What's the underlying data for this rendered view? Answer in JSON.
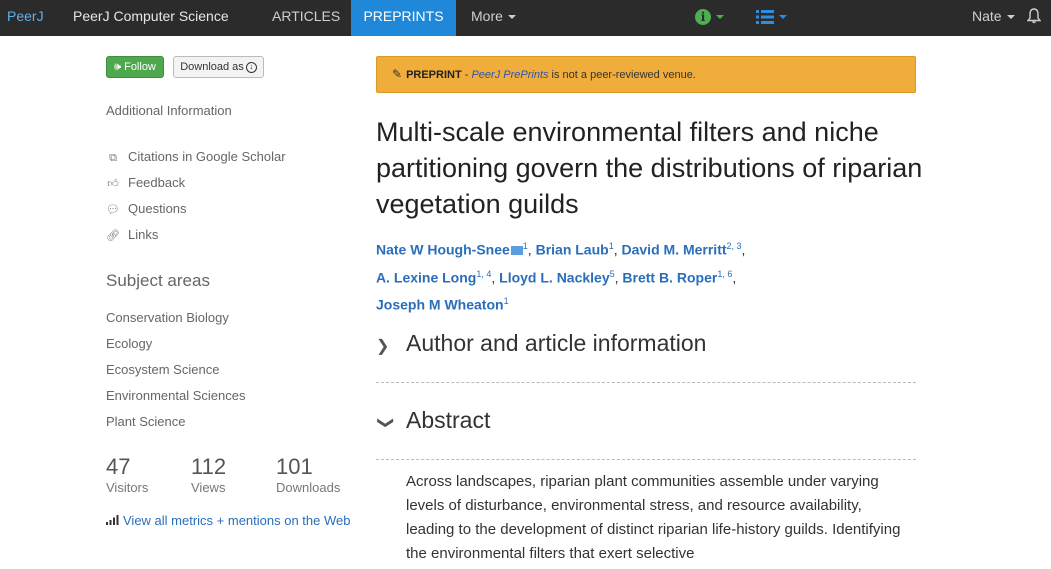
{
  "navbar": {
    "logo": "PeerJ",
    "journal": "PeerJ Computer Science",
    "articles": "ARTICLES",
    "preprints": "PREPRINTS",
    "more": "More",
    "user": "Nate",
    "colors": {
      "bg": "#2b2b2b",
      "active": "#1f88d9",
      "info": "#4caf50",
      "list": "#2d8de0"
    }
  },
  "sidebar": {
    "follow": "Follow",
    "download": "Download as",
    "additional_info": "Additional Information",
    "links": [
      {
        "icon": "copy-icon",
        "label": "Citations in Google Scholar"
      },
      {
        "icon": "thumbs-up-icon",
        "label": "Feedback"
      },
      {
        "icon": "comments-icon",
        "label": "Questions"
      },
      {
        "icon": "link-icon",
        "label": "Links"
      }
    ],
    "subject_heading": "Subject areas",
    "subjects": [
      "Conservation Biology",
      "Ecology",
      "Ecosystem Science",
      "Environmental Sciences",
      "Plant Science"
    ],
    "stats": [
      {
        "value": "47",
        "label": "Visitors"
      },
      {
        "value": "112",
        "label": "Views"
      },
      {
        "value": "101",
        "label": "Downloads"
      }
    ],
    "metrics_link": "View all metrics + mentions on the Web"
  },
  "banner": {
    "strong": "PREPRINT",
    "sep": " - ",
    "link": "PeerJ PrePrints",
    "rest": " is not a peer-reviewed venue.",
    "color": "#f0ad3b"
  },
  "article": {
    "title": "Multi-scale environmental filters and niche partitioning govern the distributions of riparian vegetation guilds",
    "authors": [
      {
        "name": "Nate W Hough-Snee",
        "sup": "1",
        "mail": true
      },
      {
        "name": "Brian Laub",
        "sup": "1"
      },
      {
        "name": "David M. Merritt",
        "sup": "2, 3"
      },
      {
        "name": "A. Lexine Long",
        "sup": "1, 4"
      },
      {
        "name": "Lloyd L. Nackley",
        "sup": "5"
      },
      {
        "name": "Brett B. Roper",
        "sup": "1, 6"
      },
      {
        "name": "Joseph M Wheaton",
        "sup": "1"
      }
    ],
    "section_author_info": "Author and article information",
    "section_abstract": "Abstract",
    "abstract_text": "Across landscapes, riparian plant communities assemble under varying levels of disturbance, environmental stress, and resource availability, leading to the development of distinct riparian life-history guilds. Identifying the environmental filters that exert selective"
  }
}
